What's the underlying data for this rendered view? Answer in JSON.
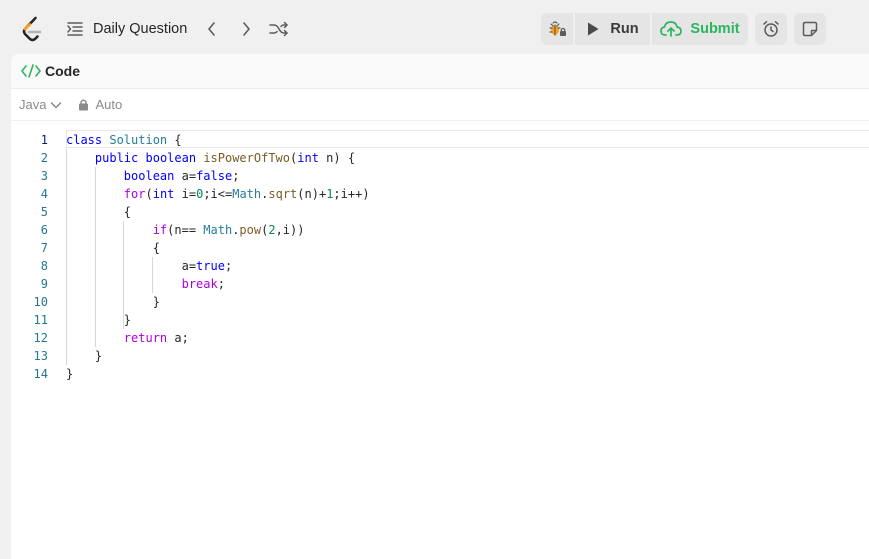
{
  "nav": {
    "problem_list_label": "Daily Question"
  },
  "actions": {
    "run_label": "Run",
    "submit_label": "Submit"
  },
  "panel": {
    "tab_title": "Code",
    "language": "Java",
    "mode": "Auto"
  },
  "editor": {
    "line_numbers": [
      "1",
      "2",
      "3",
      "4",
      "5",
      "6",
      "7",
      "8",
      "9",
      "10",
      "11",
      "12",
      "13",
      "14"
    ],
    "lines": [
      "class Solution {",
      "    public boolean isPowerOfTwo(int n) {",
      "        boolean a=false;",
      "        for(int i=0;i<=Math.sqrt(n)+1;i++)",
      "        {",
      "            if(n== Math.pow(2,i))",
      "            {",
      "                a=true;",
      "                break;",
      "            }",
      "        }",
      "        return a;",
      "    }",
      "}"
    ]
  },
  "colors": {
    "submit": "#2db55d",
    "code_tag_icon": "#2db55d",
    "keyword": "#0000ff",
    "control_keyword": "#af00db",
    "class_name": "#267f99",
    "function": "#795e26",
    "line_number": "#237893"
  },
  "icons": {
    "logo": "leetcode-logo",
    "problem_list": "list-indent-icon",
    "prev": "chevron-left-icon",
    "next": "chevron-right-icon",
    "shuffle": "shuffle-icon",
    "debug": "bug-lock-icon",
    "run": "play-icon",
    "submit": "cloud-upload-icon",
    "timer": "alarm-clock-icon",
    "notes": "note-icon",
    "code_tab": "code-brackets-icon",
    "language_caret": "chevron-down-icon",
    "auto_lock": "lock-icon"
  }
}
